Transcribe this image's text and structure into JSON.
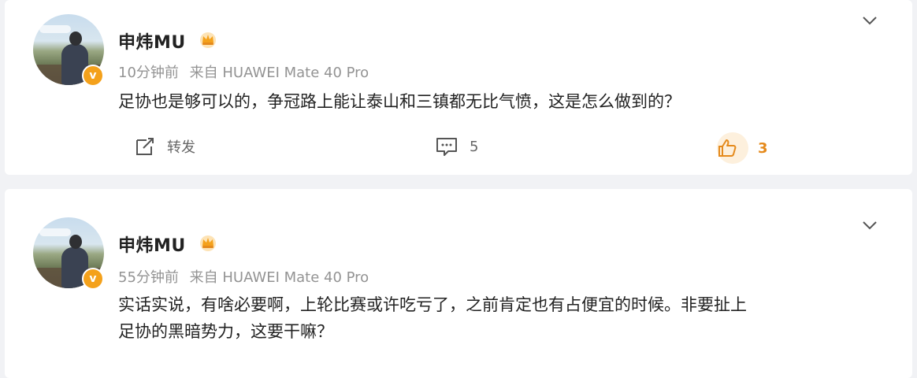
{
  "posts": [
    {
      "username": "申炜MU",
      "time": "10分钟前",
      "source": "来自 HUAWEI Mate 40 Pro",
      "content": "足协也是够可以的，争冠路上能让泰山和三镇都无比气愤，这是怎么做到的？",
      "repost_label": "转发",
      "comment_count": "5",
      "like_count": "3"
    },
    {
      "username": "申炜MU",
      "time": "55分钟前",
      "source": "来自 HUAWEI Mate 40 Pro",
      "content_line1": "实话实说，有啥必要啊，上轮比赛或许吃亏了，之前肯定也有占便宜的时候。非要扯上",
      "content_line2": "足协的黑暗势力，这要干嘛？"
    }
  ],
  "icons": {
    "verified": "verified-badge-icon",
    "crown": "crown-icon",
    "chevron": "chevron-down-icon",
    "repost": "repost-icon",
    "comment": "comment-icon",
    "like": "like-icon"
  },
  "colors": {
    "accent": "#e58a1c",
    "badge": "#f4a11b",
    "meta": "#939393"
  }
}
